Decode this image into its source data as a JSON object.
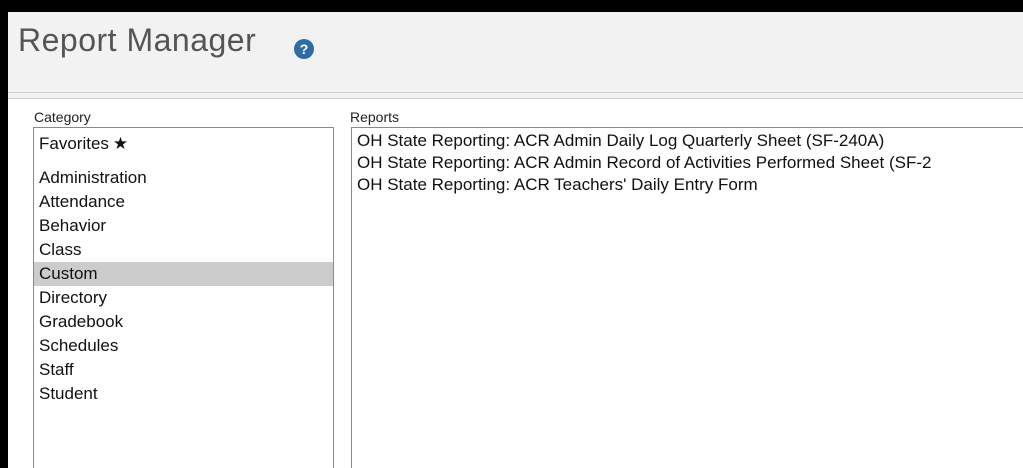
{
  "header": {
    "title": "Report Manager",
    "help_icon": "question-circle-icon",
    "help_glyph": "?",
    "accent": "#2e6da4"
  },
  "category": {
    "label": "Category",
    "favorites": {
      "label": "Favorites",
      "star": "★"
    },
    "items": [
      {
        "label": "Administration",
        "selected": false
      },
      {
        "label": "Attendance",
        "selected": false
      },
      {
        "label": "Behavior",
        "selected": false
      },
      {
        "label": "Class",
        "selected": false
      },
      {
        "label": "Custom",
        "selected": true
      },
      {
        "label": "Directory",
        "selected": false
      },
      {
        "label": "Gradebook",
        "selected": false
      },
      {
        "label": "Schedules",
        "selected": false
      },
      {
        "label": "Staff",
        "selected": false
      },
      {
        "label": "Student",
        "selected": false
      }
    ],
    "selected_color": "#cccccc"
  },
  "reports": {
    "label": "Reports",
    "items": [
      {
        "label": "OH State Reporting: ACR Admin Daily Log Quarterly Sheet (SF-240A)"
      },
      {
        "label": "OH State Reporting: ACR Admin Record of Activities Performed Sheet (SF-2"
      },
      {
        "label": "OH State Reporting: ACR Teachers' Daily Entry Form"
      }
    ]
  }
}
